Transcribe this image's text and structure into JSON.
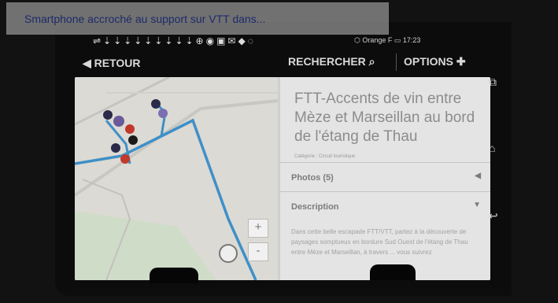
{
  "caption": {
    "text": "Smartphone accroché au support sur VTT dans..."
  },
  "status": {
    "icons": "⇌⇣⇣⇣⇣⇣⇣⇣⇣⇣⊕◉▣✉◆◌",
    "right": "⬡   Orange F ▭ 17:23"
  },
  "actionbar": {
    "back": "◀ RETOUR",
    "search": "RECHERCHER ⌕",
    "options": "OPTIONS ✚"
  },
  "panel": {
    "title": "FTT-Accents de vin entre Mèze et Marseillan au bord de l'étang de Thau",
    "subtitle": "Catégorie : Circuit touristique",
    "sections": [
      {
        "label": "Photos (5)",
        "arrow": "◀"
      },
      {
        "label": "Description",
        "arrow": "▼"
      }
    ],
    "description": "Dans cette belle escapade FTT/VTT, partez à la découverte de paysages somptueux en bordure Sud Ouest de l'étang de Thau entre Mèze et Marseillan, à travers ... vous suivrez"
  },
  "map": {
    "zoom_in": "+",
    "zoom_out": "-"
  },
  "navbar": {
    "overview": "⧉",
    "home": "⌂",
    "back": "↩"
  },
  "colors": {
    "route": "#3f90c7",
    "marker": "#2a2a4a",
    "marker_red": "#c0392b",
    "map_bg": "#dcdad4"
  }
}
